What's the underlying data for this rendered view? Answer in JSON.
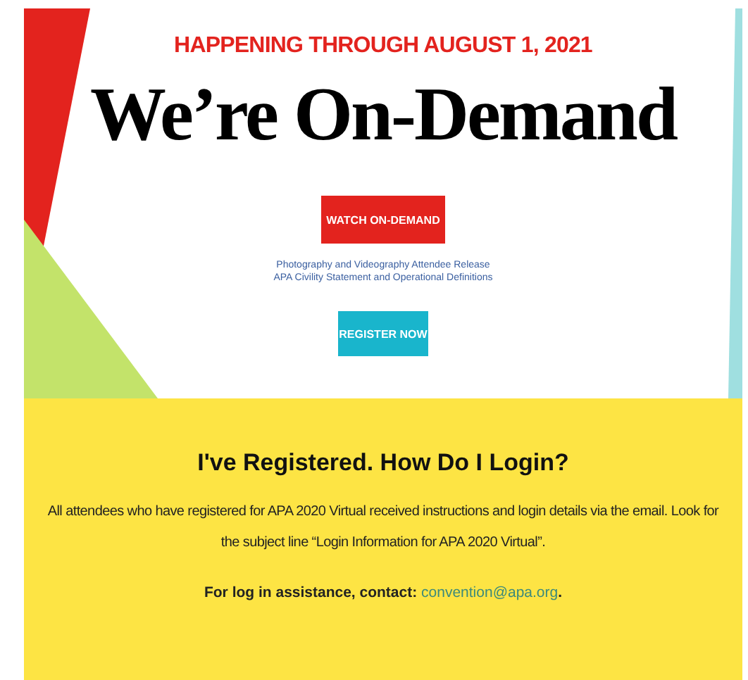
{
  "hero": {
    "date": "HAPPENING THROUGH AUGUST 1, 2021",
    "heading": "We’re On-Demand",
    "watch_button": "WATCH ON-DEMAND",
    "links": [
      "Photography and Videography Attendee Release",
      "APA Civility Statement and Operational Definitions"
    ],
    "register_button": "REGISTER NOW"
  },
  "login": {
    "heading": "I've Registered. How Do I Login?",
    "body": "All attendees who have registered for APA 2020 Virtual received instructions and login details via the email. Look for the subject line “Login Information for APA 2020 Virtual”.",
    "contact_label": "For log in assistance, contact:",
    "contact_email": "convention@apa.org",
    "contact_end": "."
  }
}
